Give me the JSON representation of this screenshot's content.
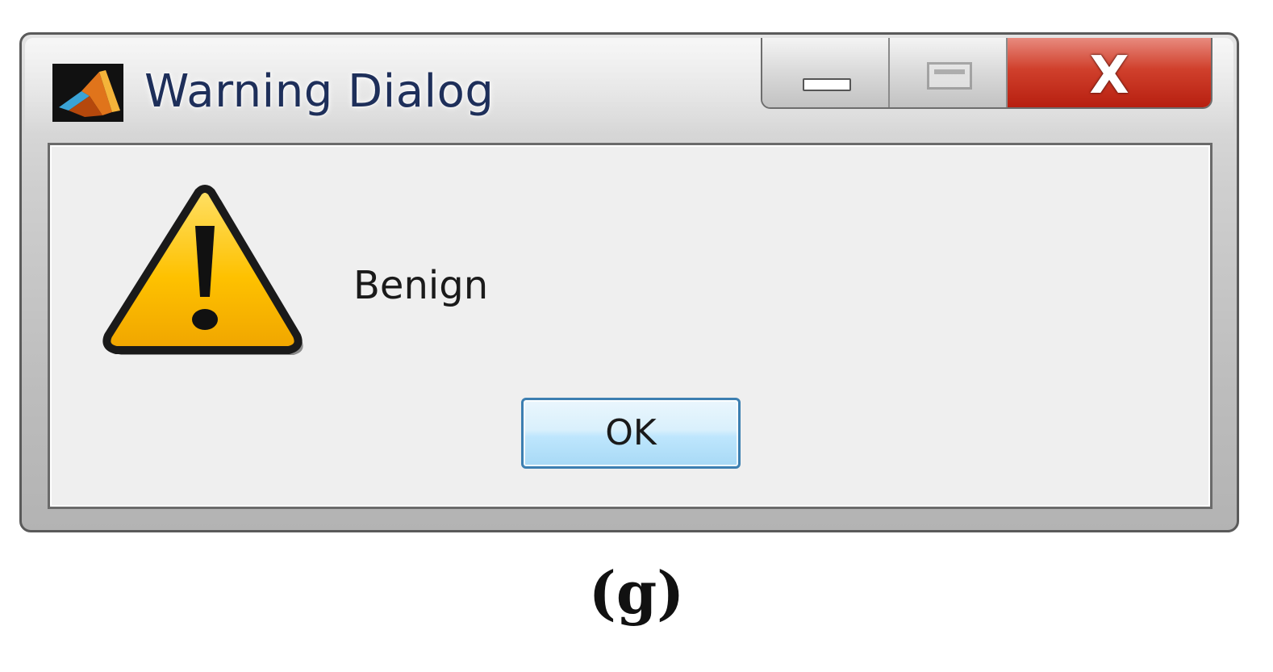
{
  "window": {
    "title": "Warning Dialog",
    "app_icon": "matlab-logo-icon",
    "caption_buttons": {
      "minimize_icon": "minimize-icon",
      "maximize_icon": "maximize-icon",
      "close_glyph": "X",
      "close_color": "#d0402c"
    }
  },
  "dialog": {
    "icon": "warning-icon",
    "icon_color": "#fec100",
    "message": "Benign",
    "ok_label": "OK"
  },
  "figure": {
    "label": "(g)"
  }
}
